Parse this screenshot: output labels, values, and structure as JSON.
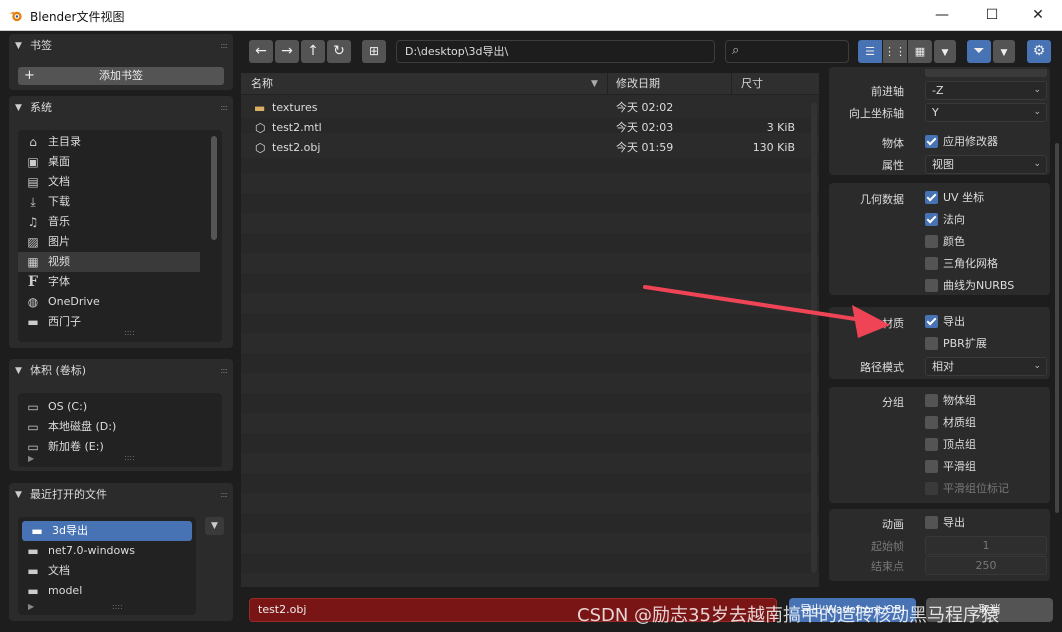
{
  "window": {
    "title": "Blender文件视图",
    "minimize": "—",
    "maximize": "☐",
    "close": "✕"
  },
  "bookmarks": {
    "header": "书签",
    "add_label": "添加书签",
    "add_icon": "plus-icon"
  },
  "system": {
    "header": "系统",
    "items": [
      {
        "label": "主目录",
        "icon": "home-icon"
      },
      {
        "label": "桌面",
        "icon": "desktop-icon"
      },
      {
        "label": "文档",
        "icon": "documents-icon"
      },
      {
        "label": "下载",
        "icon": "download-icon"
      },
      {
        "label": "音乐",
        "icon": "music-icon"
      },
      {
        "label": "图片",
        "icon": "image-icon"
      },
      {
        "label": "视频",
        "icon": "video-icon"
      },
      {
        "label": "字体",
        "icon": "font-icon"
      },
      {
        "label": "OneDrive",
        "icon": "globe-icon"
      },
      {
        "label": "西门子",
        "icon": "folder-icon"
      }
    ]
  },
  "volumes": {
    "header": "体积 (卷标)",
    "items": [
      {
        "label": "OS (C:)",
        "icon": "disk-icon"
      },
      {
        "label": "本地磁盘 (D:)",
        "icon": "disk-icon"
      },
      {
        "label": "新加卷 (E:)",
        "icon": "disk-icon"
      }
    ]
  },
  "recent": {
    "header": "最近打开的文件",
    "items": [
      {
        "label": "3d导出",
        "icon": "folder-icon"
      },
      {
        "label": "net7.0-windows",
        "icon": "folder-icon"
      },
      {
        "label": "文档",
        "icon": "folder-icon"
      },
      {
        "label": "model",
        "icon": "folder-icon"
      }
    ]
  },
  "toolbar": {
    "path": "D:\\desktop\\3d导出\\",
    "search_placeholder": ""
  },
  "filelist": {
    "columns": {
      "name": "名称",
      "date": "修改日期",
      "size": "尺寸"
    },
    "rows": [
      {
        "name": "textures",
        "date": "今天 02:02",
        "size": "",
        "icon": "folder-icon"
      },
      {
        "name": "test2.mtl",
        "date": "今天 02:03",
        "size": "3 KiB",
        "icon": "file-3d-icon"
      },
      {
        "name": "test2.obj",
        "date": "今天 01:59",
        "size": "130 KiB",
        "icon": "file-3d-icon"
      }
    ]
  },
  "options": {
    "forward_label": "前进轴",
    "forward_value": "-Z",
    "up_label": "向上坐标轴",
    "up_value": "Y",
    "object_label": "物体",
    "apply_modifiers": "应用修改器",
    "props_label": "属性",
    "props_value": "视图",
    "geometry_label": "几何数据",
    "uv": "UV 坐标",
    "normals": "法向",
    "colors": "颜色",
    "triangulate": "三角化网格",
    "nurbs": "曲线为NURBS",
    "material_label": "材质",
    "mat_export": "导出",
    "pbr": "PBR扩展",
    "path_mode_label": "路径模式",
    "path_mode_value": "相对",
    "group_label": "分组",
    "obj_groups": "物体组",
    "mat_groups": "材质组",
    "vertex_groups": "顶点组",
    "smooth_groups": "平滑组",
    "smooth_bits": "平滑组位标记",
    "anim_label": "动画",
    "anim_export": "导出",
    "start_label": "起始帧",
    "start_value": "1",
    "end_label": "结束点",
    "end_value": "250"
  },
  "bottom": {
    "filename": "test2.obj",
    "export_label": "导出 Wavefront OBJ",
    "cancel_label": "取消"
  },
  "watermark": "CSDN @励志35岁去越南搞中的造砖核动黑马程序猿",
  "colors": {
    "accent": "#4772b3",
    "filename_bg": "#7a1515",
    "arrow": "#ee4455"
  }
}
